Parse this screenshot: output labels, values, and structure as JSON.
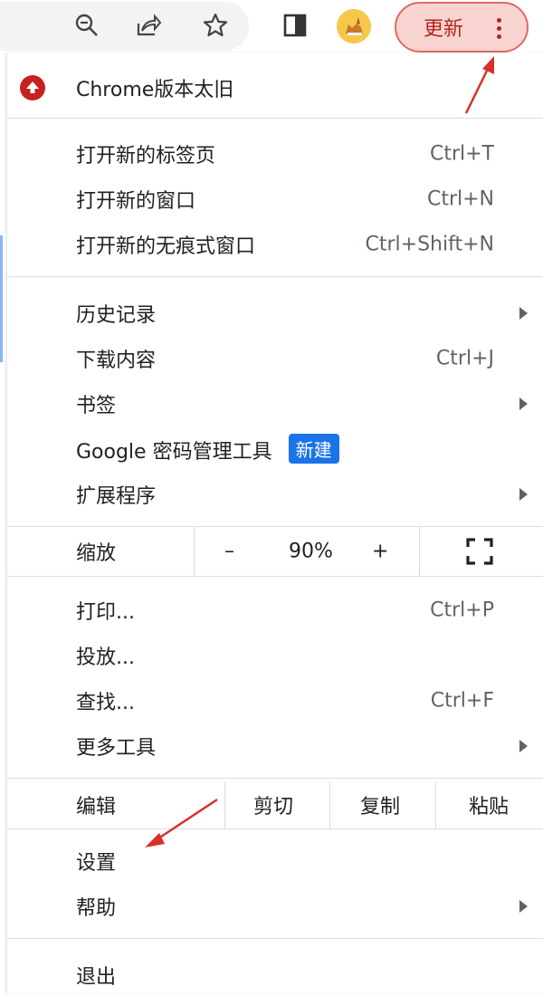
{
  "toolbar": {
    "icons": [
      "zoom-icon",
      "share-icon",
      "bookmark-star-icon",
      "side-panel-icon"
    ],
    "update_button_label": "更新",
    "accent_color": "#b3261e"
  },
  "menu": {
    "update_notice": "Chrome版本太旧",
    "group_tabs": [
      {
        "label": "打开新的标签页",
        "shortcut": "Ctrl+T"
      },
      {
        "label": "打开新的窗口",
        "shortcut": "Ctrl+N"
      },
      {
        "label": "打开新的无痕式窗口",
        "shortcut": "Ctrl+Shift+N"
      }
    ],
    "history": "历史记录",
    "downloads": {
      "label": "下载内容",
      "shortcut": "Ctrl+J"
    },
    "bookmarks": "书签",
    "password_manager": {
      "label": "Google 密码管理工具",
      "badge": "新建"
    },
    "extensions": "扩展程序",
    "zoom": {
      "label": "缩放",
      "minus": "–",
      "value": "90%",
      "plus": "+"
    },
    "print": {
      "label": "打印...",
      "shortcut": "Ctrl+P"
    },
    "cast": "投放...",
    "find": {
      "label": "查找...",
      "shortcut": "Ctrl+F"
    },
    "more_tools": "更多工具",
    "edit": {
      "label": "编辑",
      "cut": "剪切",
      "copy": "复制",
      "paste": "粘贴"
    },
    "settings": "设置",
    "help": "帮助",
    "exit": "退出"
  }
}
